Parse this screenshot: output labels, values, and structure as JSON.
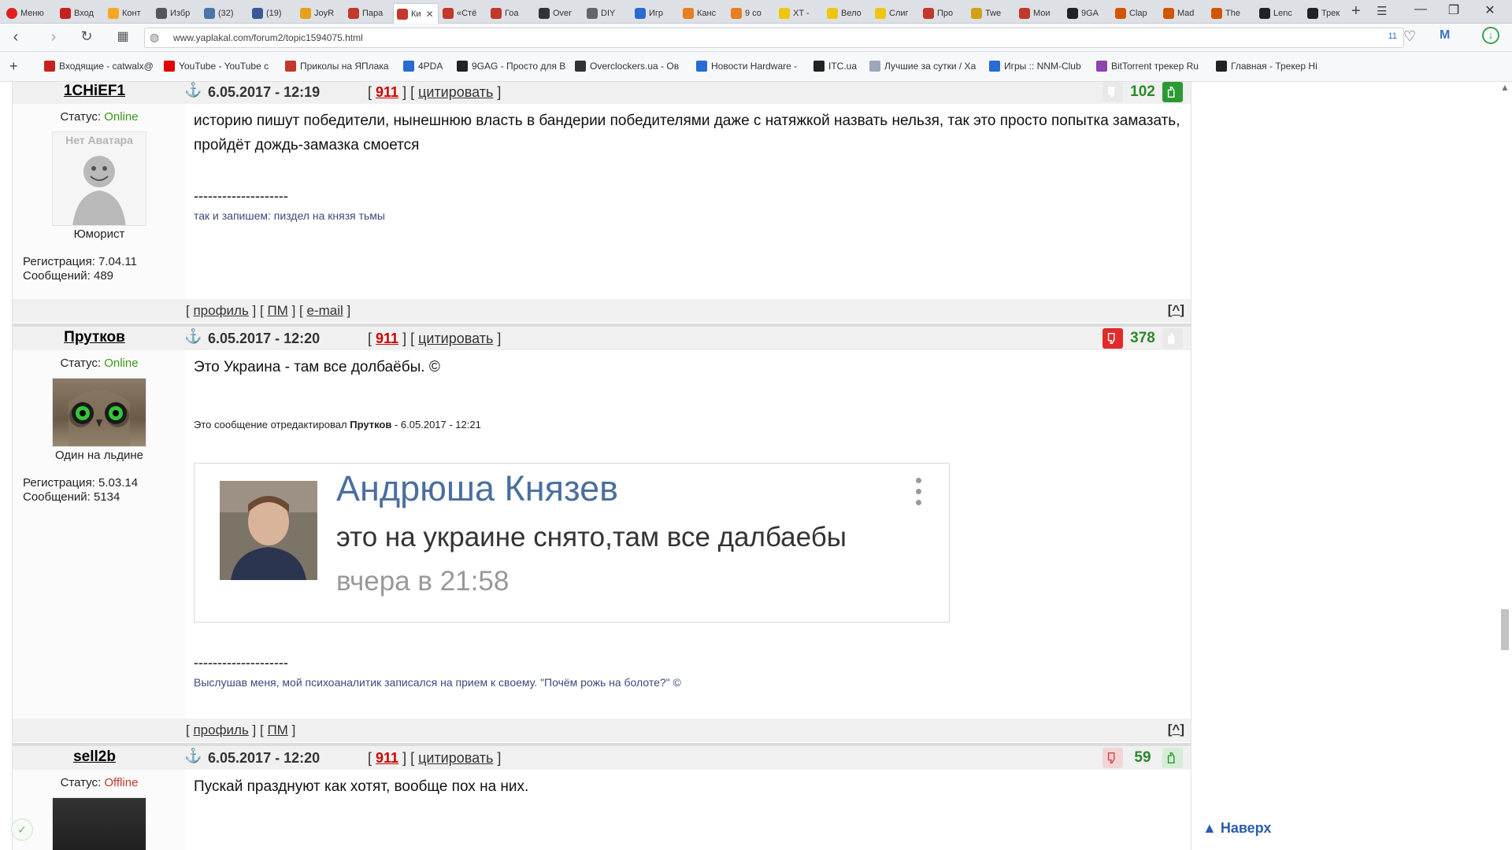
{
  "browser": {
    "menu_label": "Меню",
    "tabs": [
      {
        "label": "Вход",
        "color": "#c5221f"
      },
      {
        "label": "Конт",
        "color": "#f5a623"
      },
      {
        "label": "Избр",
        "color": "#555555"
      },
      {
        "label": "(32)",
        "color": "#4a76a8"
      },
      {
        "label": "(19)",
        "color": "#3b5998"
      },
      {
        "label": "JoyR",
        "color": "#e3a21a"
      },
      {
        "label": "Пара",
        "color": "#c0392b"
      },
      {
        "label": "Ки",
        "color": "#c0392b",
        "active": true
      },
      {
        "label": "«Стё",
        "color": "#c0392b"
      },
      {
        "label": "Гоа",
        "color": "#c0392b"
      },
      {
        "label": "Over",
        "color": "#333333"
      },
      {
        "label": "DIY",
        "color": "#666666"
      },
      {
        "label": "Игр",
        "color": "#2a6bd1"
      },
      {
        "label": "Канс",
        "color": "#e67e22"
      },
      {
        "label": "9 со",
        "color": "#e67e22"
      },
      {
        "label": "XT -",
        "color": "#f1c40f"
      },
      {
        "label": "Вело",
        "color": "#f1c40f"
      },
      {
        "label": "Слиг",
        "color": "#f1c40f"
      },
      {
        "label": "Про",
        "color": "#c0392b"
      },
      {
        "label": "Twe",
        "color": "#d4a017"
      },
      {
        "label": "Мои",
        "color": "#c0392b"
      },
      {
        "label": "9GA",
        "color": "#222222"
      },
      {
        "label": "Clap",
        "color": "#d35400"
      },
      {
        "label": "Mad",
        "color": "#d35400"
      },
      {
        "label": "The",
        "color": "#d35400"
      },
      {
        "label": "Lenc",
        "color": "#222222"
      },
      {
        "label": "Трек",
        "color": "#222222"
      }
    ],
    "url": "www.yaplakal.com/forum2/topic1594075.html",
    "url_badge": "11",
    "bookmarks": [
      {
        "label": "Входящие - catwalx@",
        "color": "#c5221f"
      },
      {
        "label": "YouTube - YouTube с",
        "color": "#e00000"
      },
      {
        "label": "Приколы на ЯПлака",
        "color": "#c0392b"
      },
      {
        "label": "4PDA",
        "color": "#2a6bd1"
      },
      {
        "label": "9GAG - Просто для В",
        "color": "#222222"
      },
      {
        "label": "Overclockers.ua - Ов",
        "color": "#333333"
      },
      {
        "label": "Новости Hardware -",
        "color": "#2a6bd1"
      },
      {
        "label": "ITC.ua",
        "color": "#222222"
      },
      {
        "label": "Лучшие за сутки / Ха",
        "color": "#9aa8b8"
      },
      {
        "label": "Игры :: NNM-Club",
        "color": "#2a6bd1"
      },
      {
        "label": "BitTorrent трекер Ru",
        "color": "#8e44ad"
      },
      {
        "label": "Главная - Трекер Hi",
        "color": "#222222"
      }
    ]
  },
  "posts": [
    {
      "author": "1CHiEF1",
      "date": "6.05.2017 - 12:19",
      "n911": "911",
      "quote_label": "цитировать",
      "rating": "102",
      "rating_state": "up",
      "status_label": "Статус:",
      "status_value": "Online",
      "rank": "Юморист",
      "avatar_alt": "Нет Аватара",
      "reg": "Регистрация: 7.04.11",
      "msgs": "Сообщений: 489",
      "text": "историю пишут победители, нынешнюю власть в бандерии победителями даже с натяжкой назвать нельзя, так это просто попытка замазать, пройдёт дождь-замазка смоется",
      "sig_line": "--------------------",
      "sig": "так и запишем: пиздел на князя тьмы",
      "foot_profile": "профиль",
      "foot_pm": "ПМ",
      "foot_email": "e-mail",
      "foot_top": "^"
    },
    {
      "author": "Прутков",
      "date": "6.05.2017 - 12:20",
      "n911": "911",
      "quote_label": "цитировать",
      "rating": "378",
      "rating_state": "down",
      "status_label": "Статус:",
      "status_value": "Online",
      "rank": "Один на льдине",
      "reg": "Регистрация: 5.03.14",
      "msgs": "Сообщений: 5134",
      "text": "Это Украина - там все долбаёбы. ©",
      "edit_prefix": "Это сообщение отредактировал",
      "edit_user": "Прутков",
      "edit_suffix": "- 6.05.2017 - 12:21",
      "embed": {
        "name": "Андрюша Князев",
        "message": "это на украине снято,там все далбаебы",
        "time": "вчера в 21:58"
      },
      "sig_line": "--------------------",
      "sig": "Выслушав меня, мой психоаналитик записался на прием к своему. \"Почём рожь на болоте?\" ©",
      "foot_profile": "профиль",
      "foot_pm": "ПМ",
      "foot_top": "^"
    },
    {
      "author": "sell2b",
      "date": "6.05.2017 - 12:20",
      "n911": "911",
      "quote_label": "цитировать",
      "rating": "59",
      "rating_state": "both",
      "status_label": "Статус:",
      "status_value": "Offline",
      "text": "Пускай празднуют как хотят, вообще пох на них."
    }
  ],
  "to_top_label": "Наверх"
}
